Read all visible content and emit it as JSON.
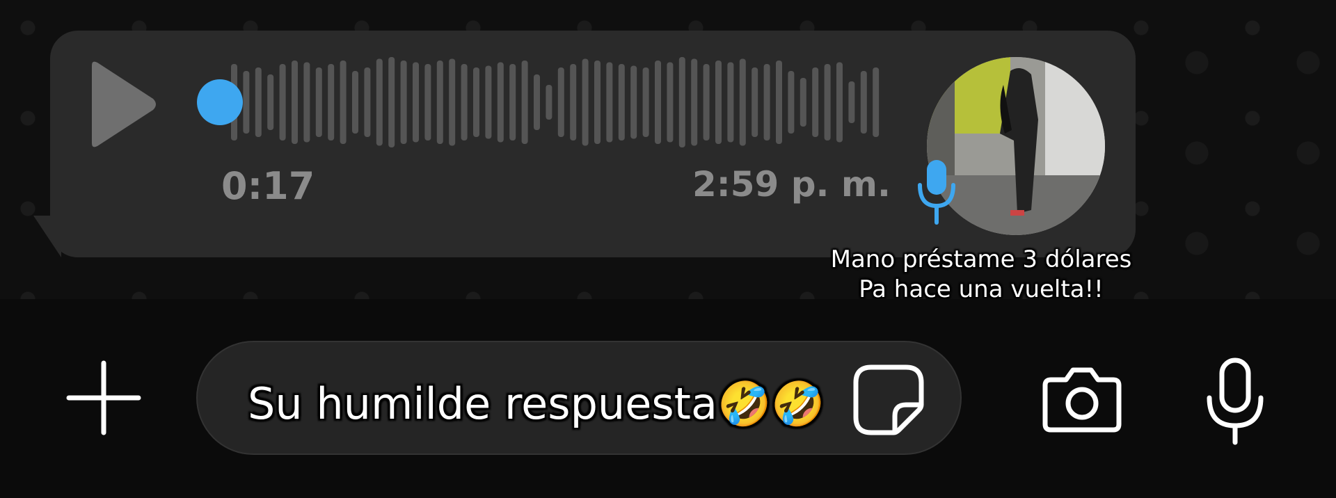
{
  "voice_message": {
    "duration": "0:17",
    "timestamp": "2:59 p. m.",
    "progress": 0,
    "accent_color": "#3ea7f0"
  },
  "avatar": {
    "icon": "contact-photo"
  },
  "caption": {
    "line1": "Mano préstame 3 dólares",
    "line2": "Pa hace una vuelta!!"
  },
  "composer": {
    "input_value": "Su humilde respuesta🤣🤣",
    "icons": [
      "plus-icon",
      "sticker-icon",
      "camera-icon",
      "microphone-icon"
    ]
  }
}
